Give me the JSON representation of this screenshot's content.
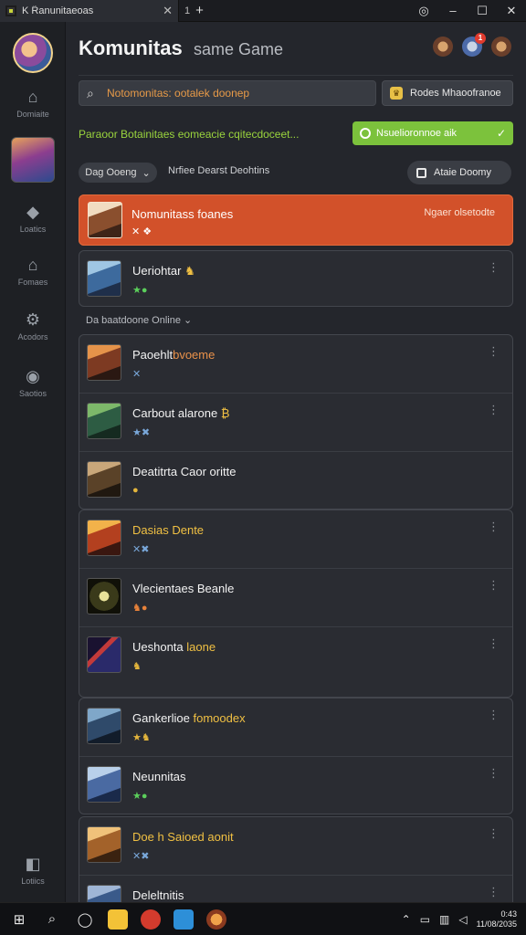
{
  "window": {
    "tab_title": "K R̃anunitaeoas",
    "tab_count": "1",
    "close_glyph": "✕",
    "new_tab_glyph": "+"
  },
  "header": {
    "title": "Komunitas",
    "subtitle": "same Game",
    "notification_count": "1"
  },
  "sidebar": {
    "items": [
      {
        "label": "Domiaite",
        "icon": "home-icon"
      },
      {
        "label": "Loatics",
        "icon": "tag-icon"
      },
      {
        "label": "Fomaes",
        "icon": "house-icon"
      },
      {
        "label": "Acodors",
        "icon": "gear-icon"
      },
      {
        "label": "Saotios",
        "icon": "location-pin-icon"
      }
    ],
    "bottom_label": "Lotiics"
  },
  "search": {
    "placeholder": "Notomonitas: ootalek doonep"
  },
  "mode_button": {
    "label": "Rodes Mhaoofranoe"
  },
  "info": {
    "text": "Paraoor Botainitaes eomeacie cqitecdoceet...",
    "button_label": "Nsuelioronnoe aik"
  },
  "filter": {
    "pill_label": "Dag Ooeng",
    "text": "Nrfiee Dearst Deohtins",
    "action_label": "Ataie Doomy"
  },
  "banner": {
    "title": "Nomunitass foanes",
    "sub": "✕ ❖",
    "right": "Ngaer olsetodte"
  },
  "rows_top": [
    {
      "title": "Ueriohtar",
      "tag": "★●",
      "extra": "♞"
    }
  ],
  "group_label": "Da baatdoone Online",
  "rows": [
    {
      "title": "Paoehlt",
      "title_hl": "bvoeme",
      "tag": "✕"
    },
    {
      "title": "Carbout alarone",
      "title_hl": "₿",
      "tag": "★✖"
    },
    {
      "title": "Deatitrta Caor oritte",
      "title_hl": "",
      "tag": "●"
    },
    {
      "title": "Dasias Dente",
      "title_hl": "",
      "tag": "✕✖"
    },
    {
      "title": "Vlecientaes Beanle",
      "title_hl": "",
      "tag": "♞●"
    },
    {
      "title": "Ueshonta",
      "title_hl": "laone",
      "tag": "♞"
    },
    {
      "title": "Gankerlioe",
      "title_hl": "fomoodex",
      "tag": "★♞"
    },
    {
      "title": "Neunnitas",
      "title_hl": "",
      "tag": "★●"
    },
    {
      "title": "Doe h Saioed aonit",
      "title_hl": "",
      "tag": "✕✖"
    },
    {
      "title": "Deleltnitis",
      "title_hl": "",
      "tag": ""
    }
  ],
  "taskbar": {
    "clock_time": "0:43",
    "clock_date": "11/08/2035"
  },
  "colors": {
    "accent": "#d2512a",
    "green": "#7cc23c",
    "bg": "#24262c"
  }
}
